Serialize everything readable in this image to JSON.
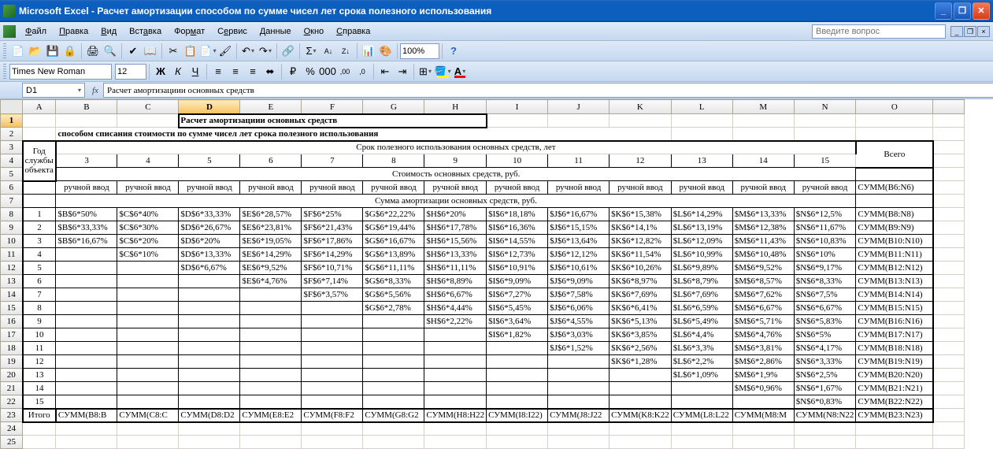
{
  "titlebar": {
    "title": "Microsoft Excel - Расчет амортизации способом по сумме чисел лет срока полезного использования"
  },
  "menu": {
    "file": "Файл",
    "edit": "Правка",
    "view": "Вид",
    "insert": "Вставка",
    "format": "Формат",
    "tools": "Сервис",
    "data": "Данные",
    "window": "Окно",
    "help": "Справка",
    "help_placeholder": "Введите вопрос"
  },
  "toolbar1": {
    "zoom": "100%"
  },
  "toolbar2": {
    "font": "Times New Roman",
    "size": "12"
  },
  "formula": {
    "namebox": "D1",
    "fx": "fx",
    "value": "Расчет амортизациии основных средств"
  },
  "cols": [
    "A",
    "B",
    "C",
    "D",
    "E",
    "F",
    "G",
    "H",
    "I",
    "J",
    "K",
    "L",
    "M",
    "N",
    "O"
  ],
  "rows": [
    1,
    2,
    3,
    4,
    5,
    6,
    7,
    8,
    9,
    10,
    11,
    12,
    13,
    14,
    15,
    16,
    17,
    18,
    19,
    20,
    21,
    22,
    23,
    24,
    25
  ],
  "content": {
    "title": "Расчет амортизациии основных средств",
    "subtitle": "способом списания стоимости по сумме чисел лет срока полезного использования",
    "year_header": "Год службы объекта",
    "period_header": "Срок полезного использования основных средств, лет",
    "total_header": "Всего",
    "periods": [
      "3",
      "4",
      "5",
      "6",
      "7",
      "8",
      "9",
      "10",
      "11",
      "12",
      "13",
      "14",
      "15"
    ],
    "cost_header": "Стоимость основных средств, руб.",
    "manual": "ручной ввод",
    "sum_b6n6": "СУММ(B6:N6)",
    "amort_header": "Сумма амортизации основных средств, руб.",
    "row_headers": [
      "1",
      "2",
      "3",
      "4",
      "5",
      "6",
      "7",
      "8",
      "9",
      "10",
      "11",
      "12",
      "13",
      "14",
      "15"
    ],
    "itogo": "Итого",
    "data": [
      [
        "$B$6*50%",
        "$C$6*40%",
        "$D$6*33,33%",
        "$E$6*28,57%",
        "$F$6*25%",
        "$G$6*22,22%",
        "$H$6*20%",
        "$I$6*18,18%",
        "$J$6*16,67%",
        "$K$6*15,38%",
        "$L$6*14,29%",
        "$M$6*13,33%",
        "$N$6*12,5%",
        "СУММ(B8:N8)"
      ],
      [
        "$B$6*33,33%",
        "$C$6*30%",
        "$D$6*26,67%",
        "$E$6*23,81%",
        "$F$6*21,43%",
        "$G$6*19,44%",
        "$H$6*17,78%",
        "$I$6*16,36%",
        "$J$6*15,15%",
        "$K$6*14,1%",
        "$L$6*13,19%",
        "$M$6*12,38%",
        "$N$6*11,67%",
        "СУММ(B9:N9)"
      ],
      [
        "$B$6*16,67%",
        "$C$6*20%",
        "$D$6*20%",
        "$E$6*19,05%",
        "$F$6*17,86%",
        "$G$6*16,67%",
        "$H$6*15,56%",
        "$I$6*14,55%",
        "$J$6*13,64%",
        "$K$6*12,82%",
        "$L$6*12,09%",
        "$M$6*11,43%",
        "$N$6*10,83%",
        "СУММ(B10:N10)"
      ],
      [
        "",
        "$C$6*10%",
        "$D$6*13,33%",
        "$E$6*14,29%",
        "$F$6*14,29%",
        "$G$6*13,89%",
        "$H$6*13,33%",
        "$I$6*12,73%",
        "$J$6*12,12%",
        "$K$6*11,54%",
        "$L$6*10,99%",
        "$M$6*10,48%",
        "$N$6*10%",
        "СУММ(B11:N11)"
      ],
      [
        "",
        "",
        "$D$6*6,67%",
        "$E$6*9,52%",
        "$F$6*10,71%",
        "$G$6*11,11%",
        "$H$6*11,11%",
        "$I$6*10,91%",
        "$J$6*10,61%",
        "$K$6*10,26%",
        "$L$6*9,89%",
        "$M$6*9,52%",
        "$N$6*9,17%",
        "СУММ(B12:N12)"
      ],
      [
        "",
        "",
        "",
        "$E$6*4,76%",
        "$F$6*7,14%",
        "$G$6*8,33%",
        "$H$6*8,89%",
        "$I$6*9,09%",
        "$J$6*9,09%",
        "$K$6*8,97%",
        "$L$6*8,79%",
        "$M$6*8,57%",
        "$N$6*8,33%",
        "СУММ(B13:N13)"
      ],
      [
        "",
        "",
        "",
        "",
        "$F$6*3,57%",
        "$G$6*5,56%",
        "$H$6*6,67%",
        "$I$6*7,27%",
        "$J$6*7,58%",
        "$K$6*7,69%",
        "$L$6*7,69%",
        "$M$6*7,62%",
        "$N$6*7,5%",
        "СУММ(B14:N14)"
      ],
      [
        "",
        "",
        "",
        "",
        "",
        "$G$6*2,78%",
        "$H$6*4,44%",
        "$I$6*5,45%",
        "$J$6*6,06%",
        "$K$6*6,41%",
        "$L$6*6,59%",
        "$M$6*6,67%",
        "$N$6*6,67%",
        "СУММ(B15:N15)"
      ],
      [
        "",
        "",
        "",
        "",
        "",
        "",
        "$H$6*2,22%",
        "$I$6*3,64%",
        "$J$6*4,55%",
        "$K$6*5,13%",
        "$L$6*5,49%",
        "$M$6*5,71%",
        "$N$6*5,83%",
        "СУММ(B16:N16)"
      ],
      [
        "",
        "",
        "",
        "",
        "",
        "",
        "",
        "$I$6*1,82%",
        "$J$6*3,03%",
        "$K$6*3,85%",
        "$L$6*4,4%",
        "$M$6*4,76%",
        "$N$6*5%",
        "СУММ(B17:N17)"
      ],
      [
        "",
        "",
        "",
        "",
        "",
        "",
        "",
        "",
        "$J$6*1,52%",
        "$K$6*2,56%",
        "$L$6*3,3%",
        "$M$6*3,81%",
        "$N$6*4,17%",
        "СУММ(B18:N18)"
      ],
      [
        "",
        "",
        "",
        "",
        "",
        "",
        "",
        "",
        "",
        "$K$6*1,28%",
        "$L$6*2,2%",
        "$M$6*2,86%",
        "$N$6*3,33%",
        "СУММ(B19:N19)"
      ],
      [
        "",
        "",
        "",
        "",
        "",
        "",
        "",
        "",
        "",
        "",
        "$L$6*1,09%",
        "$M$6*1,9%",
        "$N$6*2,5%",
        "СУММ(B20:N20)"
      ],
      [
        "",
        "",
        "",
        "",
        "",
        "",
        "",
        "",
        "",
        "",
        "",
        "$M$6*0,96%",
        "$N$6*1,67%",
        "СУММ(B21:N21)"
      ],
      [
        "",
        "",
        "",
        "",
        "",
        "",
        "",
        "",
        "",
        "",
        "",
        "",
        "$N$6*0,83%",
        "СУММ(B22:N22)"
      ]
    ],
    "totals": [
      "СУММ(B8:B",
      "СУММ(C8:C",
      "СУММ(D8:D2",
      "СУММ(E8:E2",
      "СУММ(F8:F2",
      "СУММ(G8:G2",
      "СУММ(H8:H22",
      "СУММ(I8:I22)",
      "СУММ(J8:J22",
      "СУММ(K8:K22",
      "СУММ(L8:L22",
      "СУММ(M8:M",
      "СУММ(N8:N22",
      "СУММ(B23:N23)"
    ]
  }
}
